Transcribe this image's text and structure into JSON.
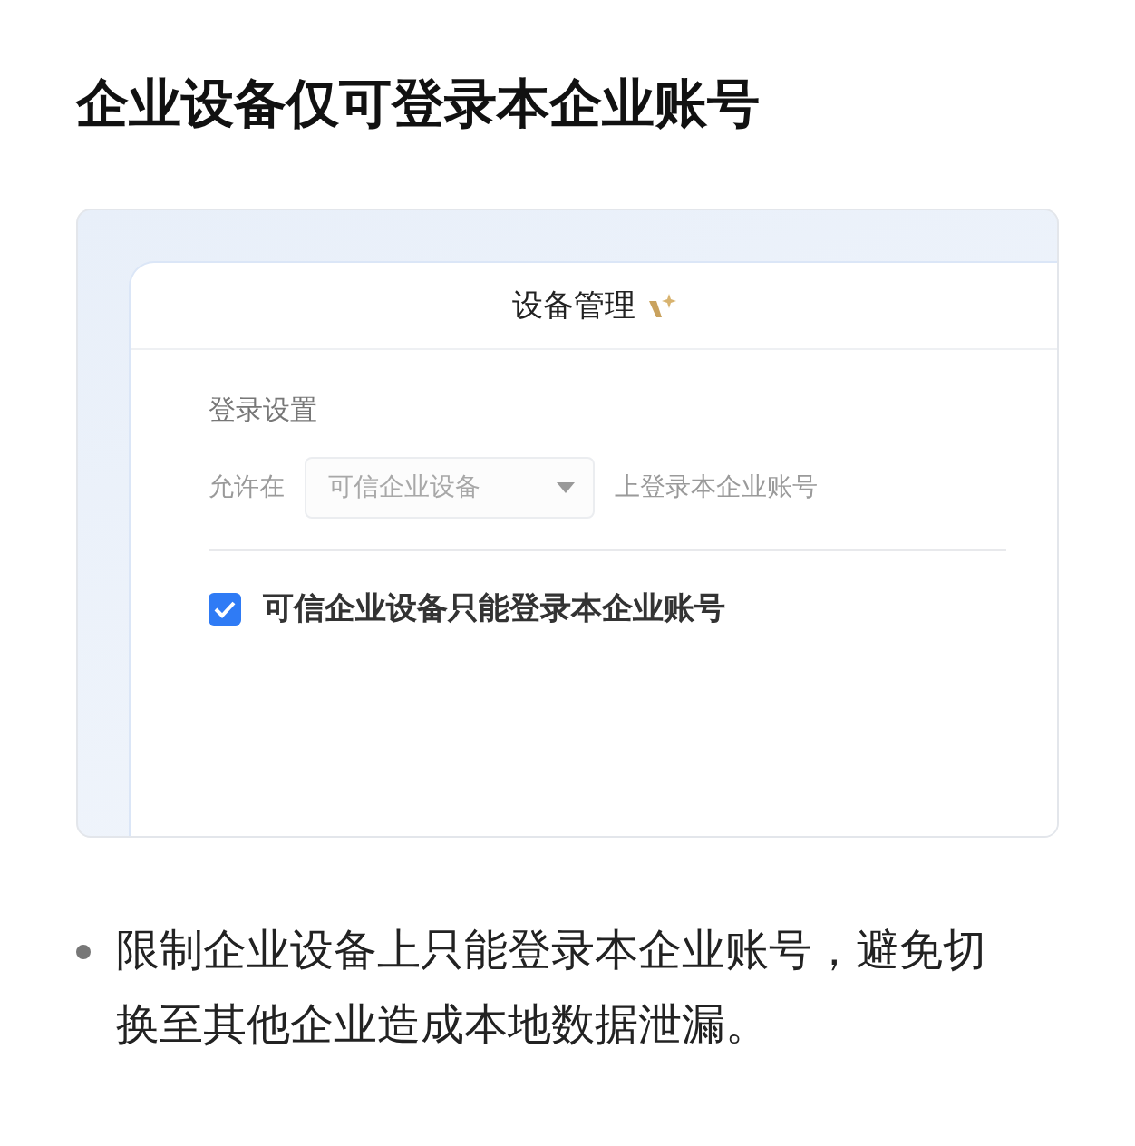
{
  "heading": "企业设备仅可登录本企业账号",
  "panel": {
    "title": "设备管理",
    "section_label": "登录设置",
    "rule": {
      "prefix": "允许在",
      "select_value": "可信企业设备",
      "suffix": "上登录本企业账号"
    },
    "checkbox": {
      "label": "可信企业设备只能登录本企业账号",
      "checked": true
    }
  },
  "bullets": [
    "限制企业设备上只能登录本企业账号，避免切换至其他企业造成本地数据泄漏。"
  ]
}
